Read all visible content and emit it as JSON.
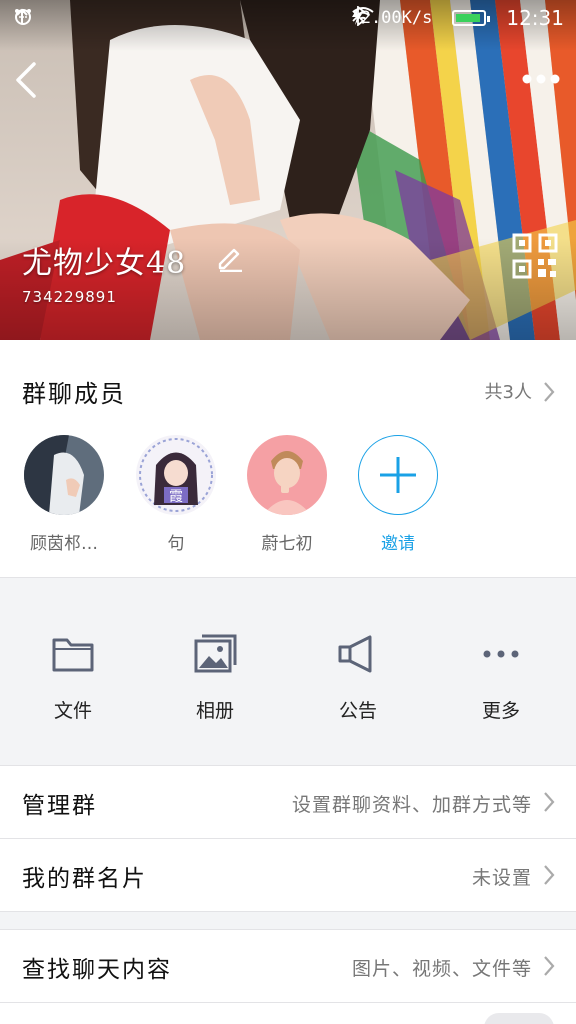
{
  "status_bar": {
    "speed": "2.00K/s",
    "time": "12:31",
    "icons": [
      "message-icon",
      "upload-icon",
      "more-dots-icon",
      "bluetooth-icon",
      "wifi-icon",
      "battery-icon",
      "charging-icon"
    ]
  },
  "header": {
    "group_name": "尤物少女48",
    "group_id": "734229891",
    "icons": [
      "back-icon",
      "more-icon",
      "edit-icon",
      "qr-code-icon"
    ]
  },
  "members": {
    "title": "群聊成员",
    "count": "共3人",
    "list": [
      {
        "name": "顾茵䢶…"
      },
      {
        "name": "句"
      },
      {
        "name": "蔚七初"
      }
    ],
    "invite_label": "邀请"
  },
  "actions": [
    {
      "label": "文件",
      "icon": "folder-icon"
    },
    {
      "label": "相册",
      "icon": "photo-album-icon"
    },
    {
      "label": "公告",
      "icon": "megaphone-icon"
    },
    {
      "label": "更多",
      "icon": "more-dots-icon"
    }
  ],
  "settings": [
    {
      "title": "管理群",
      "value": "设置群聊资料、加群方式等"
    },
    {
      "title": "我的群名片",
      "value": "未设置"
    },
    {
      "title": "查找聊天内容",
      "value": "图片、视频、文件等"
    }
  ],
  "colors": {
    "accent": "#1aa1e6",
    "battery": "#3ad15c",
    "background": "#f3f4f6"
  }
}
